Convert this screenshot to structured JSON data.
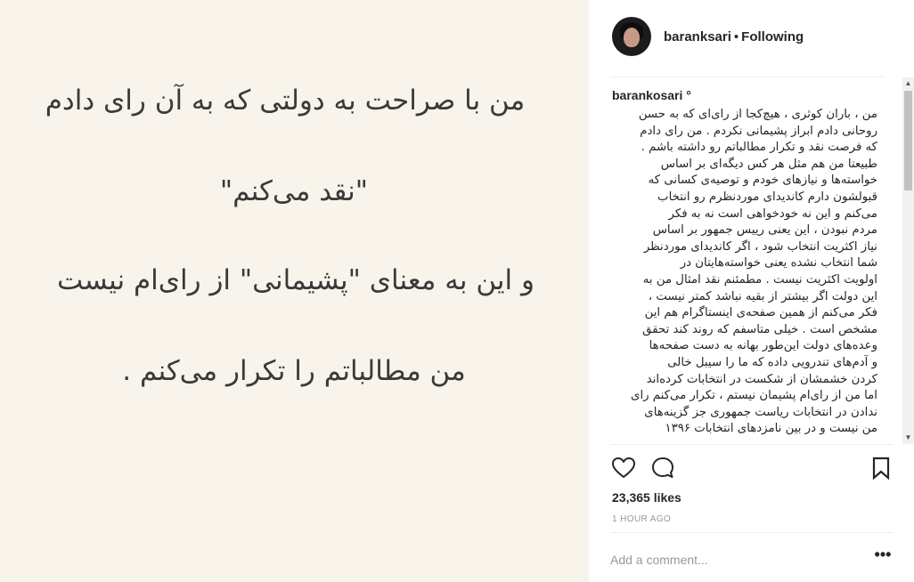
{
  "post_image": {
    "lines": [
      "من با صراحت به دولتی که به آن رای دادم",
      "\"نقد می‌کنم\"",
      "و این به معنای \"پشیمانی\" از رای‌ام نیست",
      "من مطالباتم را تکرار می‌کنم ."
    ]
  },
  "header": {
    "username": "baranksari",
    "separator": "•",
    "follow_label": "Following"
  },
  "caption": {
    "username": "barankosari",
    "verified_mark": "°",
    "lines": [
      "من ، باران کوثری ، هیچ‌کجا از رای‌ای که به حسن",
      "روحانی دادم ابراز پشیمانی نکردم . من رای دادم",
      "که فرصت نقد و تکرار مطالباتم رو داشته باشم .",
      "طبیعتا من هم مثل هر کس دیگه‌ای بر اساس",
      "خواسته‌ها و نیازهای خودم و توصیه‌ی کسانی که",
      "قبولشون دارم کاندیدای موردنظرم رو انتخاب",
      "می‌کنم و این نه خودخواهی است نه به فکر",
      "مردم نبودن ، این یعنی رییس جمهور بر اساس",
      "نیاز اکثریت انتخاب شود ، اگر کاندیدای موردنظر",
      "شما انتخاب نشده یعنی خواسته‌هایتان در",
      "اولویت اکثریت نیست . مطمئنم نقد امثال من به",
      "این دولت اگر بیشتر از بقیه نباشد کمتر نیست ،",
      "فکر می‌کنم از همین صفحه‌ی اینستاگرام هم این",
      "مشخص است . خیلی متاسفم که روند کند تحقق",
      "وعده‌های دولت این‌طور بهانه به دست صفحه‌ها",
      "و آدم‌های تندرویی داده که ما را سیبل خالی",
      "کردن خشمشان از شکست در انتخابات کرده‌اند",
      "اما من از رای‌ام پشیمان نیستم ، تکرار می‌کنم رای",
      "ندادن در انتخابات ریاست جمهوری جز گزینه‌های",
      "من نیست و در بین نامزدهای انتخابات ۱۳۹۶"
    ]
  },
  "scrollbar": {
    "up_glyph": "▲",
    "down_glyph": "▼",
    "position_fraction": 0.0
  },
  "actions": {
    "like_icon": "heart-outline",
    "comment_icon": "speech-bubble-outline",
    "save_icon": "bookmark-outline"
  },
  "likes": {
    "text": "23,365 likes"
  },
  "timestamp": {
    "text": "1 HOUR AGO"
  },
  "comment_box": {
    "placeholder": "Add a comment...",
    "more_label": "•••"
  },
  "colors": {
    "image_background": "#f8f4ec",
    "image_text": "#3a3a3a",
    "text_primary": "#262626",
    "text_secondary": "#999999",
    "divider": "#efefef"
  }
}
